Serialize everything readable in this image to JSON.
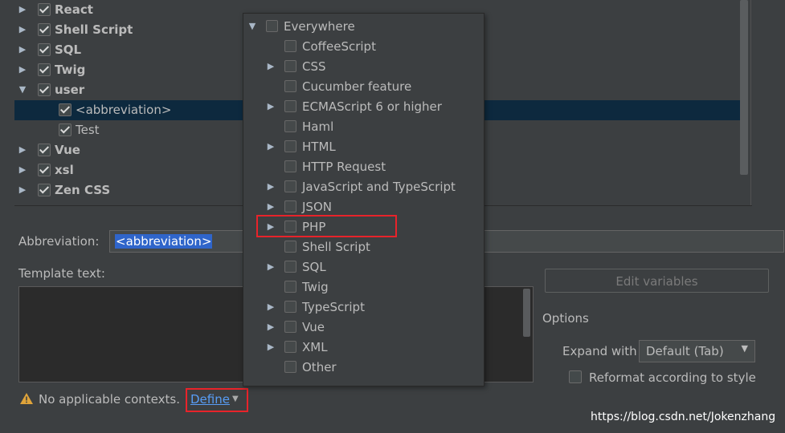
{
  "tree": {
    "items": [
      {
        "label": "React",
        "checked": true,
        "expandable": true,
        "expanded": false,
        "bold": true,
        "level": 0
      },
      {
        "label": "Shell Script",
        "checked": true,
        "expandable": true,
        "expanded": false,
        "bold": true,
        "level": 0
      },
      {
        "label": "SQL",
        "checked": true,
        "expandable": true,
        "expanded": false,
        "bold": true,
        "level": 0
      },
      {
        "label": "Twig",
        "checked": true,
        "expandable": true,
        "expanded": false,
        "bold": true,
        "level": 0
      },
      {
        "label": "user",
        "checked": true,
        "expandable": true,
        "expanded": true,
        "bold": true,
        "level": 0
      },
      {
        "label": "<abbreviation>",
        "checked": true,
        "expandable": false,
        "selected": true,
        "bold": false,
        "level": 1
      },
      {
        "label": "Test",
        "checked": true,
        "expandable": false,
        "bold": false,
        "level": 1
      },
      {
        "label": "Vue",
        "checked": true,
        "expandable": true,
        "expanded": false,
        "bold": true,
        "level": 0
      },
      {
        "label": "xsl",
        "checked": true,
        "expandable": true,
        "expanded": false,
        "bold": true,
        "level": 0
      },
      {
        "label": "Zen CSS",
        "checked": true,
        "expandable": true,
        "expanded": false,
        "bold": true,
        "level": 0
      }
    ]
  },
  "form": {
    "abbreviation_label": "Abbreviation:",
    "abbreviation_value": "<abbreviation>",
    "template_label": "Template text:",
    "edit_variables_label": "Edit variables",
    "options_label": "Options",
    "expand_with_label": "Expand with",
    "expand_with_value": "Default (Tab)",
    "reformat_label": "Reformat according to style",
    "warning_text": "No applicable contexts.",
    "define_link": "Define"
  },
  "popup": {
    "root_label": "Everywhere",
    "items": [
      {
        "label": "CoffeeScript",
        "expandable": false
      },
      {
        "label": "CSS",
        "expandable": true
      },
      {
        "label": "Cucumber feature",
        "expandable": false
      },
      {
        "label": "ECMAScript 6 or higher",
        "expandable": true
      },
      {
        "label": "Haml",
        "expandable": false
      },
      {
        "label": "HTML",
        "expandable": true
      },
      {
        "label": "HTTP Request",
        "expandable": false
      },
      {
        "label": "JavaScript and TypeScript",
        "expandable": true
      },
      {
        "label": "JSON",
        "expandable": true
      },
      {
        "label": "PHP",
        "expandable": true,
        "highlighted": true
      },
      {
        "label": "Shell Script",
        "expandable": false
      },
      {
        "label": "SQL",
        "expandable": true
      },
      {
        "label": "Twig",
        "expandable": false
      },
      {
        "label": "TypeScript",
        "expandable": true
      },
      {
        "label": "Vue",
        "expandable": true
      },
      {
        "label": "XML",
        "expandable": true
      },
      {
        "label": "Other",
        "expandable": false
      }
    ]
  },
  "watermark": "https://blog.csdn.net/Jokenzhang",
  "colors": {
    "background": "#3c3f41",
    "selection": "#0d293e",
    "link": "#589df6",
    "highlight_box": "#e8232a",
    "text_selection": "#2f65ca"
  }
}
